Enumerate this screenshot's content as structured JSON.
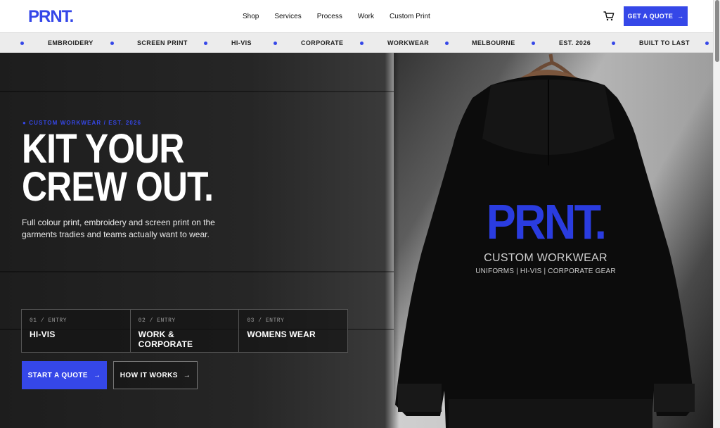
{
  "brand": {
    "logo": "PRNT.",
    "accent": "#3547e8"
  },
  "nav": {
    "items": [
      "Shop",
      "Services",
      "Process",
      "Work",
      "Custom Print"
    ],
    "cta": "GET A QUOTE",
    "cart_icon": "cart-icon"
  },
  "ticker": [
    "EMBROIDERY",
    "SCREEN PRINT",
    "HI-VIS",
    "CORPORATE",
    "WORKWEAR",
    "MELBOURNE",
    "EST. 2026",
    "BUILT TO LAST"
  ],
  "hero": {
    "eyebrow": "● CUSTOM WORKWEAR / EST. 2026",
    "headline_line1": "KIT YOUR",
    "headline_line2": "CREW OUT.",
    "lede": "Full colour print, embroidery and screen print on the garments tradies and teams actually want to wear.",
    "entries": [
      {
        "num": "01 / ENTRY",
        "title": "HI-VIS"
      },
      {
        "num": "02 / ENTRY",
        "title": "WORK & CORPORATE"
      },
      {
        "num": "03 / ENTRY",
        "title": "WOMENS WEAR"
      }
    ],
    "primary_button": "START A QUOTE",
    "secondary_button": "HOW IT WORKS",
    "hoodie": {
      "logo": "PRNT.",
      "line1": "CUSTOM WORKWEAR",
      "line2": "UNIFORMS | HI-VIS | CORPORATE GEAR"
    }
  }
}
